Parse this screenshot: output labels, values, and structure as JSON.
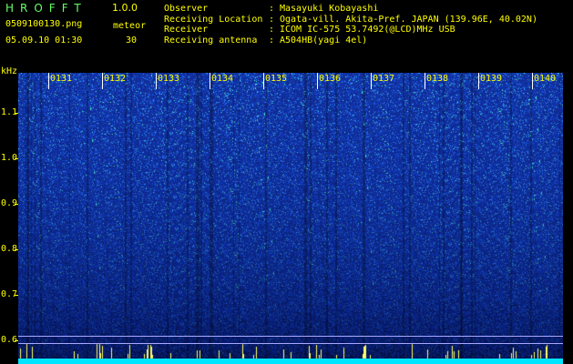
{
  "app": {
    "title": "HROFFT",
    "version": "1.0.0"
  },
  "file": {
    "name": "0509100130.png",
    "timestamp": "05.09.10 01:30"
  },
  "mode": {
    "label": "meteor",
    "count": "30"
  },
  "meta": {
    "separator": ":",
    "rows": [
      {
        "label": "Observer",
        "value": "Masayuki Kobayashi"
      },
      {
        "label": "Receiving Location",
        "value": "Ogata-vill. Akita-Pref. JAPAN (139.96E, 40.02N)"
      },
      {
        "label": "Receiver",
        "value": "ICOM IC-575 53.7492(@LCD)MHz USB"
      },
      {
        "label": "Receiving antenna",
        "value": "A504HB(yagi 4el)"
      }
    ]
  },
  "spectrogram": {
    "unit": "kHz",
    "freq_labels": [
      "1.1",
      "1.0",
      "0.9",
      "0.8",
      "0.7",
      "0.6"
    ],
    "scan_labels": [
      "0131",
      "0132",
      "0133",
      "0134",
      "0135",
      "0136",
      "0137",
      "0138",
      "0139",
      "0140"
    ],
    "colors": {
      "background": "#000000",
      "text": "#ffff00",
      "title": "#66ff66",
      "noise_low": "#1a3fb0",
      "noise_high": "#00e5ff",
      "marker_line": "#a8a8ff"
    }
  }
}
